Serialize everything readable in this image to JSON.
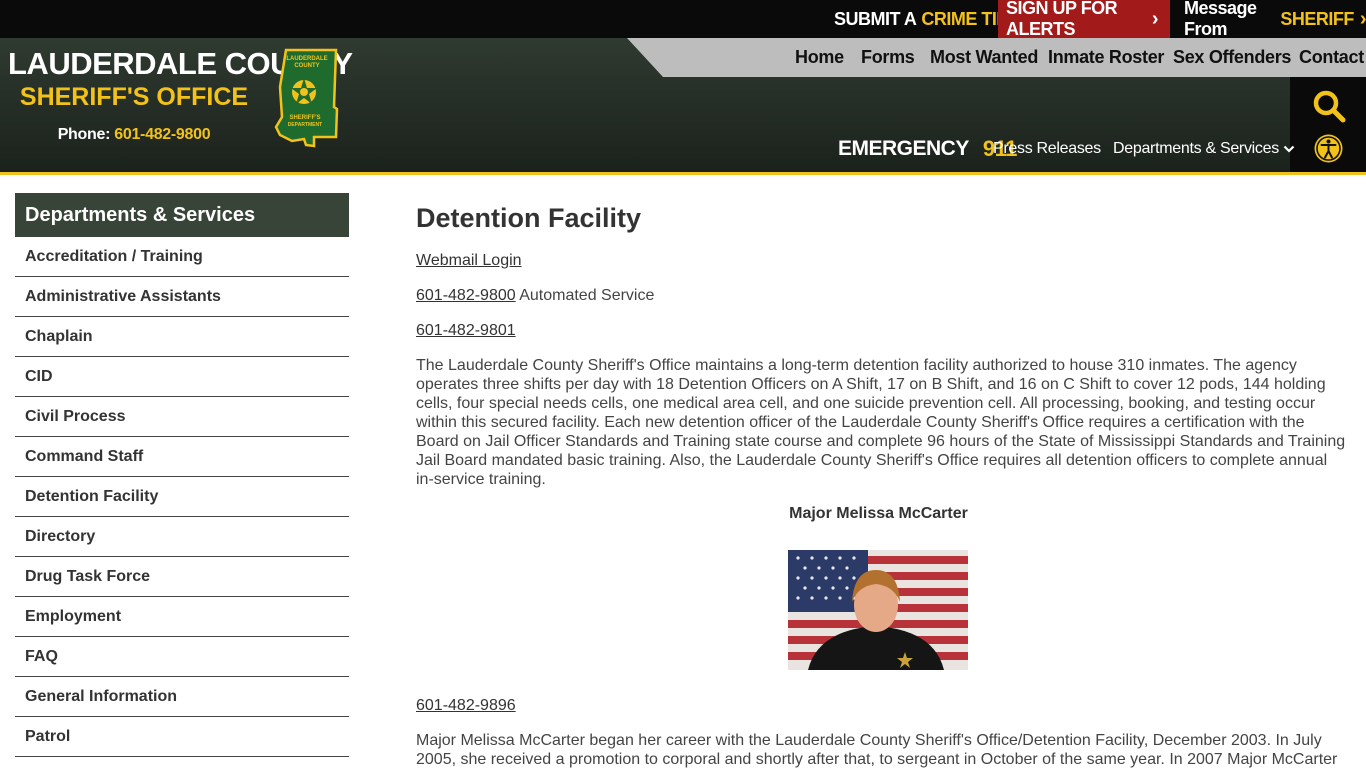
{
  "topbar": {
    "crime_tip_prefix": "SUBMIT A",
    "crime_tip_suffix": "CRIME TIP",
    "alerts": "SIGN UP FOR ALERTS",
    "sheriff_prefix": "Message From",
    "sheriff_suffix": "SHERIFF"
  },
  "brand": {
    "line1": "LAUDERDALE COUNTY",
    "line2": "SHERIFF'S OFFICE",
    "phone_label": "Phone:",
    "phone_number": "601-482-9800",
    "badge_top": "LAUDERDALE COUNTY",
    "badge_bottom": "SHERIFF'S DEPARTMENT"
  },
  "main_nav": [
    "Home",
    "Forms",
    "Most Wanted",
    "Inmate Roster",
    "Sex Offenders",
    "Contact"
  ],
  "sub_nav": {
    "emergency_label": "EMERGENCY",
    "emergency_number": "911",
    "press_releases": "Press Releases",
    "departments": "Departments & Services"
  },
  "sidebar": {
    "title": "Departments & Services",
    "items": [
      "Accreditation / Training",
      "Administrative Assistants",
      "Chaplain",
      "CID",
      "Civil Process",
      "Command Staff",
      "Detention Facility",
      "Directory",
      "Drug Task Force",
      "Employment",
      "FAQ",
      "General Information",
      "Patrol"
    ]
  },
  "content": {
    "title": "Detention Facility",
    "webmail": "Webmail Login",
    "phone1": "601-482-9800",
    "phone1_suffix": "Automated Service",
    "phone2": "601-482-9801",
    "paragraph": "The Lauderdale County Sheriff's Office maintains a long-term detention facility authorized to house 310 inmates. The agency operates three shifts per day with 18 Detention Officers on A Shift, 17 on B Shift, and 16 on C Shift to cover 12 pods, 144 holding cells, four special needs cells, one medical area cell, and one suicide prevention cell.  All processing, booking, and testing occur within this secured facility. Each new detention officer of the Lauderdale County Sheriff's Office requires a certification with the Board on Jail Officer Standards and Training state course and complete 96 hours of the State of Mississippi Standards and Training Jail Board mandated basic training.  Also, the Lauderdale County Sheriff's Office requires all detention officers to complete annual in-service training.",
    "caption": "Major Melissa McCarter",
    "phone3": "601-482-9896",
    "bio": "Major Melissa McCarter began her career with the Lauderdale County Sheriff's Office/Detention Facility, December 2003. In July 2005, she received a promotion to corporal and shortly after that, to sergeant in October of the same year. In 2007 Major McCarter"
  },
  "colors": {
    "accent_yellow": "#f2c21b",
    "header_green": "#2f3a30",
    "alert_red": "#a31a1a",
    "sidebar_title": "#384438"
  }
}
